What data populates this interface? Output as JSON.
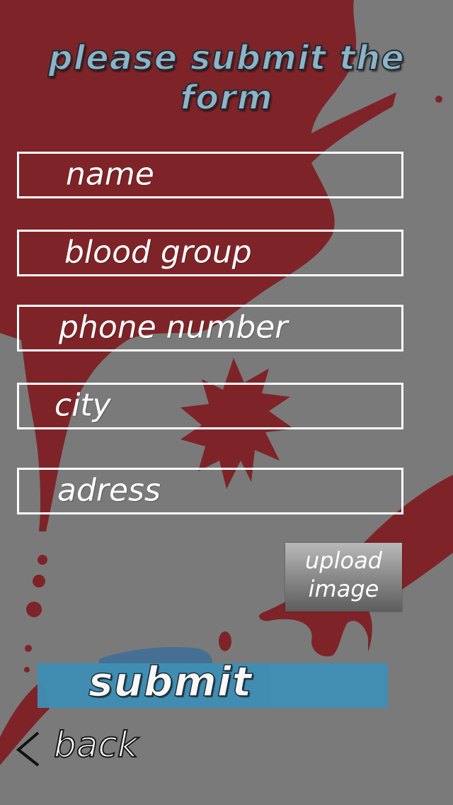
{
  "title": "please submit the form",
  "fields": [
    {
      "label": "name"
    },
    {
      "label": "blood group"
    },
    {
      "label": "phone number"
    },
    {
      "label": "city"
    },
    {
      "label": "adress"
    }
  ],
  "upload_button": {
    "line1": "upload",
    "line2": "image"
  },
  "submit_label": "submit",
  "back_label": "back",
  "colors": {
    "background": "#7a7a7a",
    "blood": "#7e2428",
    "submit_bg": "#3f8fb5",
    "field_border": "#ffffff"
  },
  "icons": {
    "back": "chevron-left-icon"
  }
}
